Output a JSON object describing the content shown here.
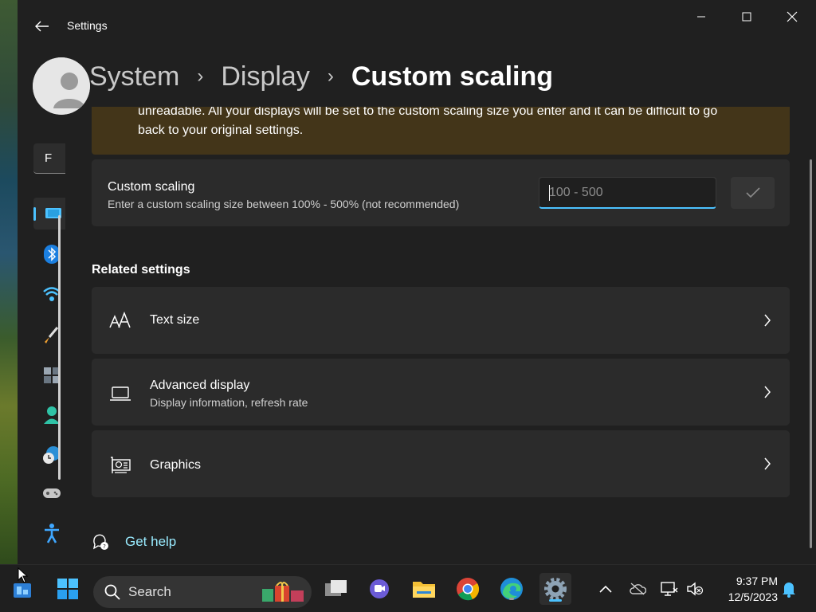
{
  "window": {
    "app_title": "Settings",
    "breadcrumb": [
      "System",
      "Display"
    ],
    "breadcrumb_current": "Custom scaling",
    "accent_color": "#4cc2ff"
  },
  "nav": {
    "find_placeholder_letter": "F",
    "icons": [
      "display-icon",
      "bluetooth-icon",
      "wifi-icon",
      "personalization-brush-icon",
      "apps-icon",
      "accounts-icon",
      "time-language-icon",
      "gaming-icon",
      "accessibility-icon"
    ]
  },
  "warning": {
    "text_line1": "unreadable. All your displays will be set to the custom scaling size you enter and it can be difficult to go",
    "text_line2": "back to your original settings."
  },
  "custom_scaling": {
    "title": "Custom scaling",
    "description": "Enter a custom scaling size between 100% - 500% (not recommended)",
    "input_placeholder": "100 - 500",
    "input_value": ""
  },
  "related": {
    "heading": "Related settings",
    "items": [
      {
        "icon": "text-size-icon",
        "title": "Text size",
        "subtitle": ""
      },
      {
        "icon": "laptop-icon",
        "title": "Advanced display",
        "subtitle": "Display information, refresh rate"
      },
      {
        "icon": "graphics-card-icon",
        "title": "Graphics",
        "subtitle": ""
      }
    ]
  },
  "help": {
    "label": "Get help"
  },
  "taskbar": {
    "search_label": "Search",
    "apps": [
      "widgets-icon",
      "start-icon",
      "task-view-icon",
      "teams-chat-icon",
      "file-explorer-icon",
      "chrome-icon",
      "edge-icon",
      "settings-icon"
    ],
    "clock_time": "9:37 PM",
    "clock_date": "12/5/2023"
  }
}
